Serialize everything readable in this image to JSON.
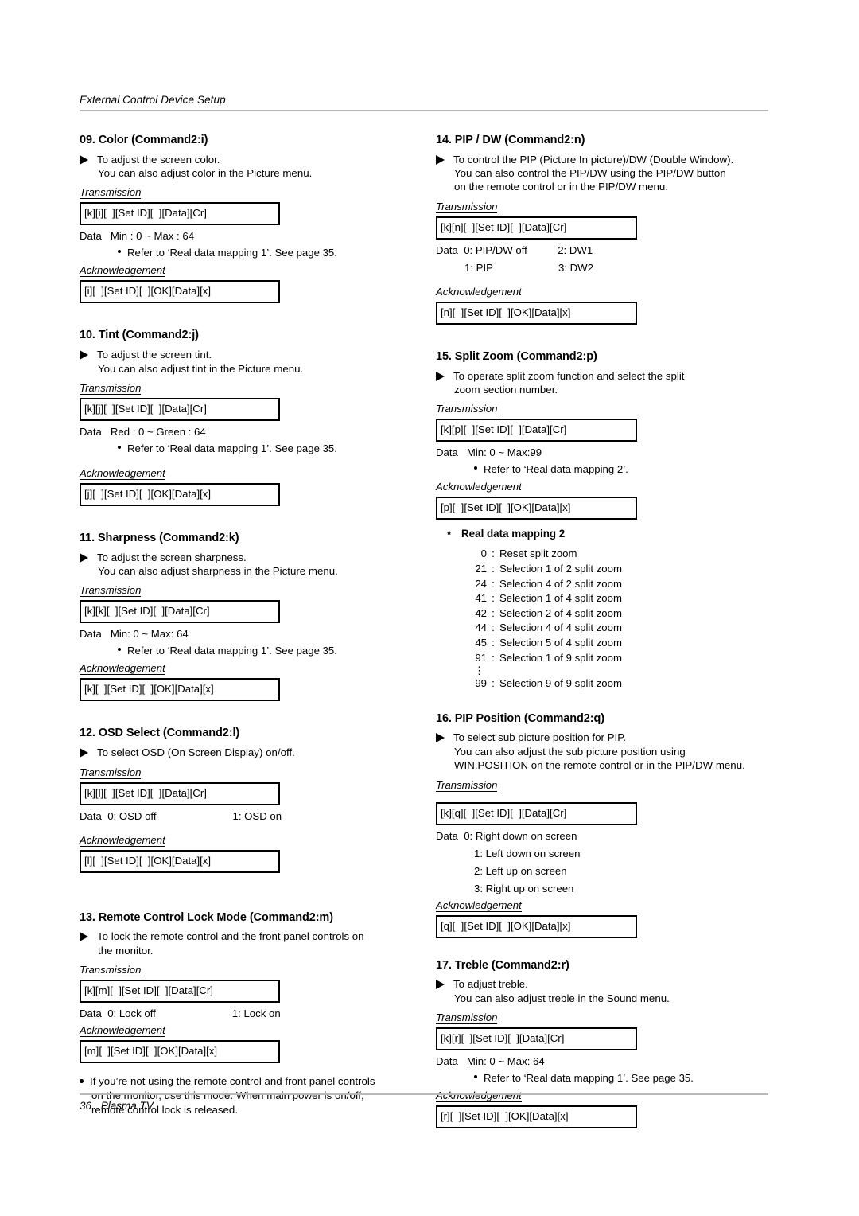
{
  "header": {
    "title": "External Control Device Setup"
  },
  "labels": {
    "transmission": "Transmission",
    "acknowledgement": "Acknowledgement",
    "data": "Data"
  },
  "left_column": [
    {
      "id": "color",
      "title": "09. Color (Command2:i)",
      "desc_lines": [
        "To adjust the screen color.",
        "You can also adjust color in the Picture menu."
      ],
      "transmission_box": "[k][i][  ][Set ID][  ][Data][Cr]",
      "data_label": "Data",
      "data_value": "Min : 0 ~ Max : 64",
      "note": "Refer to ‘Real data mapping 1’. See page 35.",
      "ack_box": "[i][  ][Set ID][  ][OK][Data][x]"
    },
    {
      "id": "tint",
      "title": "10. Tint (Command2:j)",
      "desc_lines": [
        "To adjust the screen tint.",
        "You can also adjust tint in the Picture menu."
      ],
      "transmission_box": "[k][j][  ][Set ID][  ][Data][Cr]",
      "data_label": "Data",
      "data_value": "Red : 0 ~ Green : 64",
      "note": "Refer to ‘Real data mapping 1’. See page 35.",
      "ack_box": "[j][  ][Set ID][  ][OK][Data][x]"
    },
    {
      "id": "sharpness",
      "title": "11. Sharpness (Command2:k)",
      "desc_lines": [
        "To adjust the screen sharpness.",
        "You can also adjust sharpness in the Picture menu."
      ],
      "transmission_box": "[k][k][  ][Set ID][  ][Data][Cr]",
      "data_label": "Data",
      "data_value": "Min: 0 ~ Max: 64",
      "note": "Refer to ‘Real data mapping 1’. See page 35.",
      "ack_box": "[k][  ][Set ID][  ][OK][Data][x]"
    },
    {
      "id": "osd-select",
      "title": "12. OSD Select (Command2:l)",
      "desc_lines": [
        "To select OSD (On Screen Display) on/off."
      ],
      "transmission_box": "[k][l][  ][Set ID][  ][Data][Cr]",
      "data_label": "Data",
      "data_option_1": "0: OSD off",
      "data_option_2": "1: OSD on",
      "ack_box": "[l][  ][Set ID][  ][OK][Data][x]"
    },
    {
      "id": "remote-control-lock-mode",
      "title": "13. Remote Control Lock Mode (Command2:m)",
      "desc_lines": [
        "To lock the remote control and the front panel controls on",
        "the monitor."
      ],
      "transmission_box": "[k][m][  ][Set ID][  ][Data][Cr]",
      "data_label": "Data",
      "data_option_1": "0: Lock off",
      "data_option_2": "1: Lock on",
      "ack_box": "[m][  ][Set ID][  ][OK][Data][x]",
      "footnote_lines": [
        "If you’re not using the remote control and front panel controls",
        "on the monitor, use this mode. When main power is on/off,",
        "remote control lock is released."
      ]
    }
  ],
  "right_column": [
    {
      "id": "pip-dw",
      "title": "14. PIP / DW (Command2:n)",
      "desc_lines": [
        "To control the PIP (Picture In picture)/DW (Double Window).",
        "You can also control the PIP/DW using the PIP/DW button",
        "on the remote control or in the PIP/DW menu."
      ],
      "transmission_box": "[k][n][  ][Set ID][  ][Data][Cr]",
      "data_label": "Data",
      "data_rows": [
        {
          "left": "0: PIP/DW off",
          "right": "2: DW1"
        },
        {
          "left": "1: PIP",
          "right": "3: DW2"
        }
      ],
      "ack_box": "[n][  ][Set ID][  ][OK][Data][x]"
    },
    {
      "id": "split-zoom",
      "title": "15. Split Zoom (Command2:p)",
      "desc_lines": [
        "To operate split zoom function and select the split",
        "zoom section number."
      ],
      "transmission_box": "[k][p][  ][Set ID][  ][Data][Cr]",
      "data_label": "Data",
      "data_value": "Min: 0 ~ Max:99",
      "note": "Refer to ‘Real data mapping 2’.",
      "ack_box": "[p][  ][Set ID][  ][OK][Data][x]",
      "mapping": {
        "star": "*",
        "title": "Real data mapping 2",
        "rows": [
          {
            "key": "0",
            "sep": ":",
            "value": "Reset split zoom"
          },
          {
            "key": "21",
            "sep": ":",
            "value": "Selection 1 of 2 split zoom"
          },
          {
            "key": "24",
            "sep": ":",
            "value": "Selection 4 of 2 split zoom"
          },
          {
            "key": "41",
            "sep": ":",
            "value": "Selection 1 of 4 split zoom"
          },
          {
            "key": "42",
            "sep": ":",
            "value": "Selection 2 of 4 split zoom"
          },
          {
            "key": "44",
            "sep": ":",
            "value": "Selection 4 of 4 split zoom"
          },
          {
            "key": "45",
            "sep": ":",
            "value": "Selection 5 of 4 split zoom"
          },
          {
            "key": "91",
            "sep": ":",
            "value": "Selection 1 of 9 split zoom"
          }
        ],
        "ellipsis": "⋮",
        "last_row": {
          "key": "99",
          "sep": ":",
          "value": "Selection 9 of 9 split zoom"
        }
      }
    },
    {
      "id": "pip-position",
      "title": "16. PIP Position (Command2:q)",
      "desc_lines": [
        "To select sub picture position for PIP.",
        "You can also adjust the sub picture position using",
        "WIN.POSITION on the remote control or in the PIP/DW menu."
      ],
      "transmission_box": "[k][q][  ][Set ID][  ][Data][Cr]",
      "data_label": "Data",
      "data_options": [
        "0: Right down on screen",
        "1: Left down on screen",
        "2: Left up on screen",
        "3: Right up on screen"
      ],
      "ack_box": "[q][  ][Set ID][  ][OK][Data][x]"
    },
    {
      "id": "treble",
      "title": "17. Treble (Command2:r)",
      "desc_lines": [
        "To adjust treble.",
        "You can also adjust treble in the Sound menu."
      ],
      "transmission_box": "[k][r][  ][Set ID][  ][Data][Cr]",
      "data_label": "Data",
      "data_value": "Min: 0 ~ Max: 64",
      "note": "Refer to ‘Real data mapping 1’. See page 35.",
      "ack_box": "[r][  ][Set ID][  ][OK][Data][x]"
    }
  ],
  "footer": {
    "page_number": "36",
    "product": "Plasma TV"
  }
}
